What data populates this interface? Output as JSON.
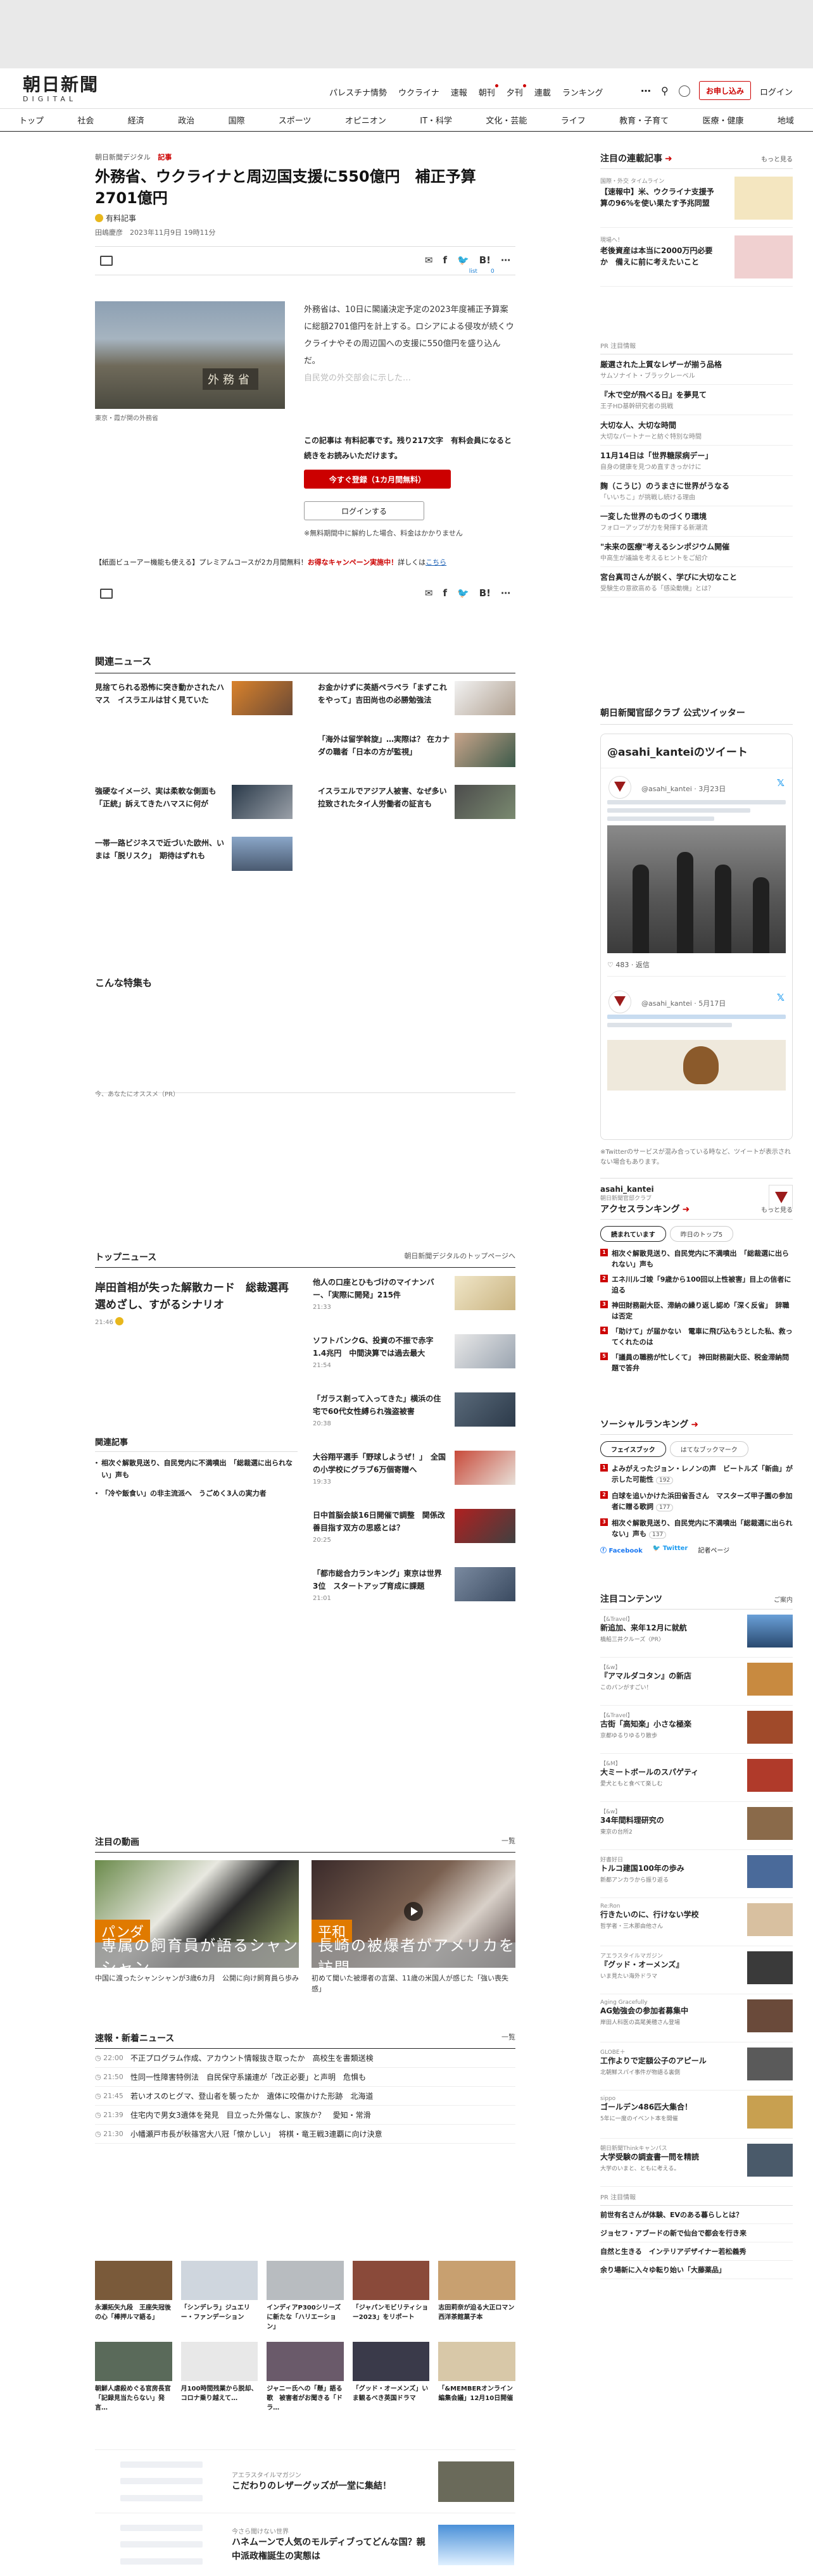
{
  "header": {
    "logo_main": "朝日新聞",
    "logo_sub": "DIGITAL",
    "nav": [
      "パレスチナ情勢",
      "ウクライナ",
      "速報",
      "朝刊",
      "夕刊",
      "連載",
      "ランキング"
    ],
    "subscribe": "お申し込み",
    "login": "ログイン"
  },
  "categories": [
    "トップ",
    "社会",
    "経済",
    "政治",
    "国際",
    "スポーツ",
    "オピニオン",
    "IT・科学",
    "文化・芸能",
    "ライフ",
    "教育・子育て",
    "医療・健康",
    "地域"
  ],
  "article": {
    "breadcrumb": "朝日新聞デジタル",
    "section": "記事",
    "title": "外務省、ウクライナと周辺国支援に550億円　補正予算2701億円",
    "paid_label": "有料記事",
    "byline": "田嶋慶彦　2023年11月9日 19時11分",
    "share_counts": [
      "list",
      "0"
    ],
    "photo_sign": "外務省",
    "photo_caption": "東京・霞が関の外務省",
    "lead": "外務省は、10日に閣議決定予定の2023年度補正予算案に総額2701億円を計上する。ロシアによる侵攻が続くウクライナやその周辺国への支援に550億円を盛り込んだ。",
    "lead_fade": "自民党の外交部会に示した…",
    "paywall_text": "この記事は 有料記事です。残り217文字　有料会員になると続きをお読みいただけます。",
    "register_button": "今すぐ登録（1カ月間無料）",
    "login_button": "ログインする",
    "note": "※無料期間中に解約した場合、料金はかかりません",
    "promo_prefix": "【紙面ビューアー機能も使える】プレミアムコースが2カ月間無料！",
    "promo_highlight": "お得なキャンペーン実施中！",
    "promo_suffix": "詳しくは",
    "promo_link": "こちら"
  },
  "related_news": {
    "title": "関連ニュース",
    "items": [
      "見捨てられる恐怖に突き動かされたハマス　イスラエルは甘く見ていた",
      "お金かけずに英語ペラペラ「まずこれをやって」吉田尚也の必勝勉強法",
      "「海外は留学斡旋」…実際は？ 在カナダの職者「日本の方が監視」",
      "強硬なイメージ、実は柔軟な側面も　「正統」訴えてきたハマスに何が",
      "イスラエルでアジア人被害、なぜ多い　拉致されたタイ人労働者の証言も",
      "一帯一路ビジネスで近づいた欧州、いまは「脱リスク」　期待はずれも"
    ]
  },
  "tokushu": {
    "title": "こんな特集も",
    "recommend": "今、あなたにオススメ（PR）"
  },
  "top_news": {
    "title": "トップニュース",
    "link": "朝日新聞デジタルのトップページへ",
    "main_title": "岸田首相が失った解散カード　総裁選再選めざし、すがるシナリオ",
    "main_time": "21:46",
    "related_title": "関連記事",
    "related": [
      "相次ぐ解散見送り、自民党内に不満噴出　「総裁選に出られない」声も",
      "「冷や飯食い」の非主流派へ　うごめく3人の実力者"
    ],
    "items": [
      {
        "title": "他人の口座とひもづけのマイナンバー、「実際に開発」215件",
        "time": "21:33"
      },
      {
        "title": "ソフトバンクG、投資の不振で赤字1.4兆円　中間決算では過去最大",
        "time": "21:54"
      },
      {
        "title": "「ガラス割って入ってきた」横浜の住宅で60代女性縛られ強盗被害",
        "time": "20:38"
      },
      {
        "title": "大谷翔平選手「野球しようぜ！」　全国の小学校にグラブ6万個寄贈へ",
        "time": "19:33"
      },
      {
        "title": "日中首脳会談16日開催で調整　関係改善目指す双方の思惑とは？",
        "time": "20:25"
      },
      {
        "title": "「都市総合力ランキング」東京は世界3位　スタートアップ育成に課題",
        "time": "21:01"
      }
    ]
  },
  "videos": {
    "title": "注目の動画",
    "more": "一覧",
    "items": [
      {
        "tag": "パンダ",
        "band": "専属の飼育員が語るシャンシャン",
        "caption": "中国に渡ったシャンシャンが3歳6カ月　公開に向け飼育員ら歩み"
      },
      {
        "tag": "平和",
        "band": "長崎の被爆者がアメリカを訪問",
        "caption": "初めて聞いた被爆者の言葉、11歳の米国人が感じた「強い喪失感」"
      }
    ]
  },
  "flash": {
    "title": "速報・新着ニュース",
    "more": "一覧",
    "items": [
      {
        "time": "22:00",
        "title": "不正プログラム作成、アカウント情報抜き取ったか　高校生を書類送検"
      },
      {
        "time": "21:50",
        "title": "性同一性障害特例法　自民保守系議連が「改正必要」と声明　危惧も"
      },
      {
        "time": "21:45",
        "title": "若いオスのヒグマ、登山者を襲ったか　遺体に咬傷かけた形跡　北海道"
      },
      {
        "time": "21:39",
        "title": "住宅内で男女3遺体を発見　目立った外傷なし、家族か？　愛知・常滑"
      },
      {
        "time": "21:30",
        "title": "小幡瀬戸市長が秋篠宮大八冠「懐かしい」　将棋・竜王戦3連覇に向け決意"
      }
    ]
  },
  "promos": [
    "永瀬拓矢九段　王座失冠後の心「棒押ルマ語る」",
    "「シンデレラ」ジュエリー・ファンデーション",
    "インディアP300シリーズに新たな「ハリエーション」",
    "「ジャパンモビリティショー2023」をリポート",
    "志田莉奈が迫る大正ロマン西洋茶館菓子本",
    "朝鮮人虐殺めぐる官房長官「記録見当たらない」発言…",
    "月100時間残業から脱却、コロナ乗り越えて…",
    "ジャニー氏への「懸」語る歌　被害者がお聞きる「ドラ…",
    "「グッド・オーメンズ」いま観るべき英国ドラマ",
    "「&MEMBERオンライン編集会議」12月10日開催"
  ],
  "mag_rows": [
    {
      "src": "アエラスタイルマガジン",
      "title": "こだわりのレザーグッズが一堂に集結！"
    },
    {
      "src": "今さら聞けない世界",
      "title": "ハネムーンで人気のモルディブってどんな国？親中派政権誕生の実態は"
    }
  ],
  "sidebar": {
    "featured_title": "注目の連載記事",
    "featured_more": "もっと見る",
    "featured": [
      {
        "cat": "国際・外交 タイムライン",
        "title": "【速報中】米、ウクライナ支援予算の96%を使い果たす予兆同盟"
      },
      {
        "cat": "現場へ！",
        "title": "老後資産は本当に2000万円必要か　備えに前に考えたいこと"
      }
    ],
    "pr_label": "PR 注目情報",
    "pr_items": [
      {
        "title": "厳選された上質なレザーが揃う品格",
        "sponsor": "サムソナイト・ブラックレーベル"
      },
      {
        "title": "『木で空が飛べる日』を夢見て",
        "sponsor": "王子HD基幹研究者の挑戦"
      },
      {
        "title": "大切な人、大切な時間",
        "sponsor": "大切なパートナーと紡ぐ特別な時間"
      },
      {
        "title": "11月14日は「世界糖尿病デー」",
        "sponsor": "自身の健康を見つめ直すきっかけに"
      },
      {
        "title": "麹（こうじ）のうまさに世界がうなる",
        "sponsor": "「いいちこ」が挑戦し続ける理由"
      },
      {
        "title": "一変した世界のものづくり環境",
        "sponsor": "フォローアップが力を発揮する新潮流"
      },
      {
        "title": "\"未来の医療\"考えるシンポジウム開催",
        "sponsor": "中高生が議論を考えるヒントをご紹介"
      },
      {
        "title": "宮台真司さんが説く、学びに大切なこと",
        "sponsor": "受験生の意欲高める「感染動機」とは？"
      }
    ],
    "twitter_title": "朝日新聞官邸クラブ 公式ツイッター",
    "twitter_header": "@asahi_kanteiのツイート",
    "tweet_handle1": "@asahi_kantei · 3月23日",
    "tweet_handle2": "@asahi_kantei · 5月17日",
    "tweet_meta": "483 · 返信",
    "twitter_note": "※Twitterのサービスが混み合っている時など、ツイートが表示されない場合もあります。",
    "account_name": "asahi_kantei",
    "account_sub": "朝日新聞官邸クラブ",
    "access_title": "アクセスランキング",
    "access_more": "もっと見る",
    "access_tabs": [
      "読まれています",
      "昨日のトップ5"
    ],
    "access_items": [
      "相次ぐ解散見送り、自民党内に不満噴出　「総裁選に出られない」声も",
      "エネ川ルゴ竣「9歳から100回以上性被害」目上の信者に迫る",
      "神田財務副大臣、滞納の繰り返し認め「深く反省」　辞職は否定",
      "「助けて」が届かない　電車に飛び込もうとした私、救ってくれたのは",
      "「議員の職務が忙しくて」　神田財務副大臣、税金滞納問題で答弁"
    ],
    "social_title": "ソーシャルランキング",
    "social_tabs": [
      "フェイスブック",
      "はてなブックマーク"
    ],
    "social_items": [
      {
        "title": "よみがえったジョン・レノンの声　ビートルズ「新曲」が示した可能性",
        "count": "192"
      },
      {
        "title": "白球を追いかけた浜田省吾さん　マスターズ甲子園の参加者に贈る歌詞",
        "count": "177"
      },
      {
        "title": "相次ぐ解散見送り、自民党内に不満噴出「総裁選に出られない」声も",
        "count": "137"
      }
    ],
    "social_foot": [
      "Facebook",
      "Twitter",
      "記者ページ"
    ],
    "contents_title": "注目コンテンツ",
    "contents_more": "ご案内",
    "contents": [
      {
        "src": "【&Travel】",
        "title": "新追加、来年12月に就航",
        "sub": "橋船三井クルーズ〈PR〉"
      },
      {
        "src": "【&w】",
        "title": "『アマルダコタン』の新店",
        "sub": "このパンがすごい！"
      },
      {
        "src": "【&Travel】",
        "title": "古街「高知楽」小さな極楽",
        "sub": "京都ゆるりゆるり散歩"
      },
      {
        "src": "【&M】",
        "title": "大ミートボールのスパゲティ",
        "sub": "愛犬ともと食べて楽しむ"
      },
      {
        "src": "【&w】",
        "title": "34年間料理研究の",
        "sub": "東京の台所2"
      },
      {
        "src": "好書好日",
        "title": "トルコ建国100年の歩み",
        "sub": "新都アンカラから振り返る"
      },
      {
        "src": "Re:Ron",
        "title": "行きたいのに、行けない学校",
        "sub": "哲学者・三木那由他さん"
      },
      {
        "src": "アエラスタイルマガジン",
        "title": "『グッド・オーメンズ』",
        "sub": "いま見たい海外ドラマ"
      },
      {
        "src": "Aging Gracefully",
        "title": "AG勉強会の参加者募集中",
        "sub": "岸田人科医の高尾美穂さん登場"
      },
      {
        "src": "GLOBE＋",
        "title": "工作よりで定額公子のアピール",
        "sub": "北朝鮮スパイ事件が物語る裏側"
      },
      {
        "src": "sippo",
        "title": "ゴールデン486匹大集合！",
        "sub": "5年に一度のイベント本を開催"
      },
      {
        "src": "朝日新聞Thinkキャンパス",
        "title": "大学受験の調査書一問を精読",
        "sub": "大学のいまと、ともに考える。"
      }
    ],
    "pr2_label": "PR 注目情報",
    "pr2": [
      "前世有名さんが体験、EVのある暮らしとは？",
      "ジョセフ・アブードの新で仙台で都会を行き来",
      "自然と生きる　インテリアデザイナー若松義秀",
      "余り場新に入々ゆ転り始い「大藤薬品」"
    ]
  }
}
